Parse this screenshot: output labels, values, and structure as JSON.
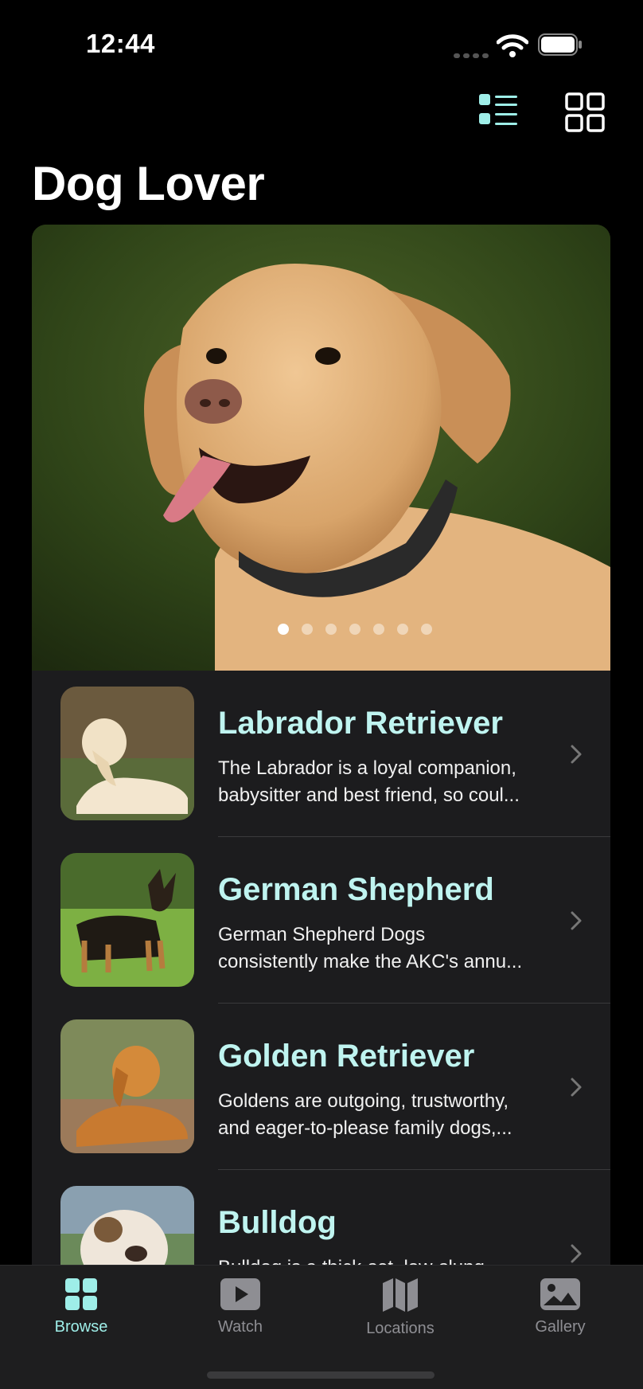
{
  "status_bar": {
    "time": "12:44"
  },
  "app": {
    "title": "Dog Lover"
  },
  "colors": {
    "accent": "#9eeee8",
    "title_accent": "#bff4f0",
    "list_bg": "#1c1c1e",
    "tabbar_bg": "#1e1e1f"
  },
  "toolbar": {
    "list_icon": "list-view-icon",
    "grid_icon": "grid-view-icon"
  },
  "hero": {
    "page_count": 7,
    "current_page": 1
  },
  "breeds": [
    {
      "name": "Labrador Retriever",
      "desc_line1": "The Labrador is a loyal companion,",
      "desc_line2": "babysitter and best friend, so coul..."
    },
    {
      "name": "German Shepherd",
      "desc_line1": "German Shepherd Dogs",
      "desc_line2": "consistently make the AKC's annu..."
    },
    {
      "name": "Golden Retriever",
      "desc_line1": "Goldens are outgoing, trustworthy,",
      "desc_line2": "and eager-to-please family dogs,..."
    },
    {
      "name": "Bulldog",
      "desc_line1": "Bulldog is a thick-set, low-slung",
      "desc_line2": ""
    }
  ],
  "tabs": [
    {
      "label": "Browse",
      "icon": "browse-icon",
      "active": true
    },
    {
      "label": "Watch",
      "icon": "play-icon",
      "active": false
    },
    {
      "label": "Locations",
      "icon": "map-icon",
      "active": false
    },
    {
      "label": "Gallery",
      "icon": "photo-icon",
      "active": false
    }
  ]
}
